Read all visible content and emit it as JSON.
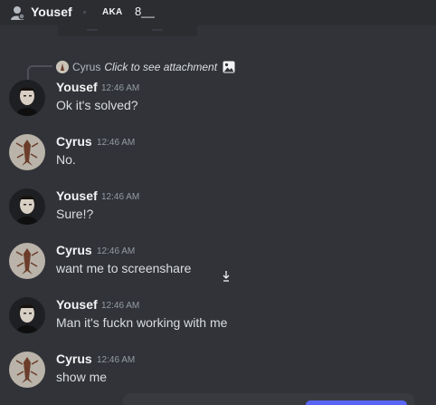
{
  "header": {
    "dm_name": "Yousef",
    "aka_label": "AKA",
    "aka_value": "8__"
  },
  "reply": {
    "author": "Cyrus",
    "text": "Click to see attachment",
    "icon": "image-icon"
  },
  "messages": [
    {
      "author": "Yousef",
      "time": "12:46 AM",
      "text": "Ok it's solved?",
      "avatar": "yousef-avatar"
    },
    {
      "author": "Cyrus",
      "time": "12:46 AM",
      "text": "No.",
      "avatar": "cyrus-avatar"
    },
    {
      "author": "Yousef",
      "time": "12:46 AM",
      "text": "Sure!?",
      "avatar": "yousef-avatar"
    },
    {
      "author": "Cyrus",
      "time": "12:46 AM",
      "text": "want me to screenshare",
      "avatar": "cyrus-avatar"
    },
    {
      "author": "Yousef",
      "time": "12:46 AM",
      "text": "Man it's fuckn working with me",
      "avatar": "yousef-avatar"
    },
    {
      "author": "Cyrus",
      "time": "12:46 AM",
      "text": "show me",
      "avatar": "cyrus-avatar"
    }
  ],
  "colors": {
    "background": "#313338",
    "header_background": "#2b2d31",
    "text": "#dbdee1",
    "username": "#f2f3f5",
    "timestamp": "#949ba4",
    "accent": "#5865f2"
  }
}
